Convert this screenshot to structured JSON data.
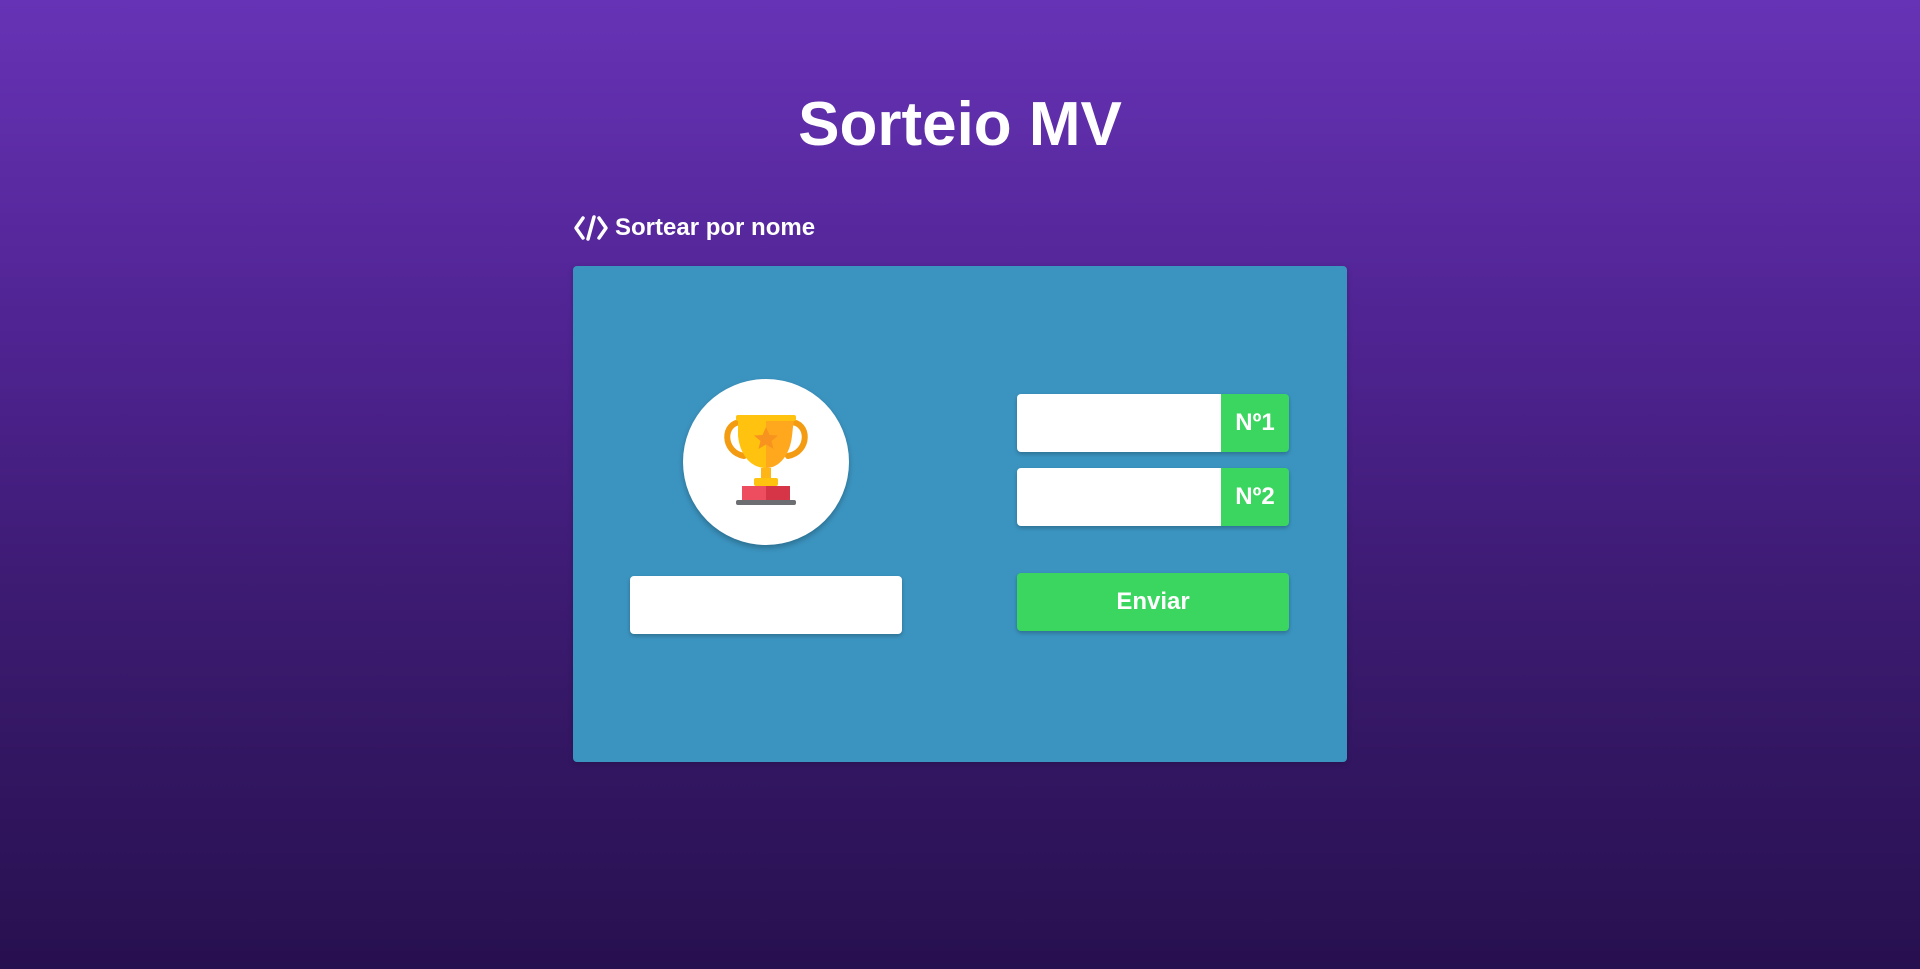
{
  "header": {
    "title": "Sorteio MV"
  },
  "section": {
    "label": "Sortear por nome",
    "icon": "code-slash-icon"
  },
  "panel": {
    "background_color": "#3b94c0",
    "trophy_icon": "trophy-icon",
    "winner_field": {
      "value": "",
      "placeholder": ""
    },
    "number_fields": [
      {
        "badge": "Nº1",
        "value": ""
      },
      {
        "badge": "Nº2",
        "value": ""
      }
    ],
    "send_label": "Enviar",
    "accent_color": "#3ad65f"
  }
}
